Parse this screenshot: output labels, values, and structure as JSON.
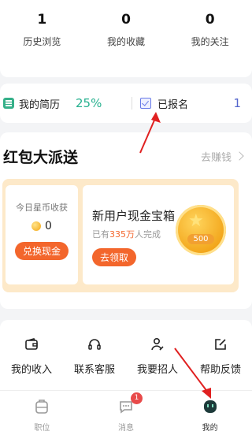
{
  "stats": [
    {
      "value": "1",
      "label": "历史浏览"
    },
    {
      "value": "0",
      "label": "我的收藏"
    },
    {
      "value": "0",
      "label": "我的关注"
    }
  ],
  "resume": {
    "label": "我的简历",
    "percent": "25%",
    "signed_label": "已报名",
    "signed_count": "1"
  },
  "packet": {
    "title": "红包大派送",
    "earn_link": "去赚钱",
    "today_label": "今日星币收获",
    "coin_value": "0",
    "exchange_button": "兑换现金",
    "newbie_title": "新用户现金宝箱",
    "done_prefix": "已有",
    "done_highlight": "335万",
    "done_suffix": "人完成",
    "get_button": "去领取",
    "coin_amount": "500"
  },
  "tools": [
    {
      "label": "我的收入",
      "icon": "wallet-icon"
    },
    {
      "label": "联系客服",
      "icon": "headset-icon"
    },
    {
      "label": "我要招人",
      "icon": "recruit-person-icon"
    },
    {
      "label": "帮助反馈",
      "icon": "edit-feedback-icon"
    }
  ],
  "tabbar": [
    {
      "label": "职位",
      "icon": "briefcase-icon",
      "active": false
    },
    {
      "label": "消息",
      "icon": "message-icon",
      "badge": "1",
      "active": false
    },
    {
      "label": "我的",
      "icon": "profile-face-icon",
      "active": true
    }
  ],
  "colors": {
    "accent_orange": "#f3662c",
    "teal": "#27b18f",
    "annotation_red": "#e02020"
  }
}
